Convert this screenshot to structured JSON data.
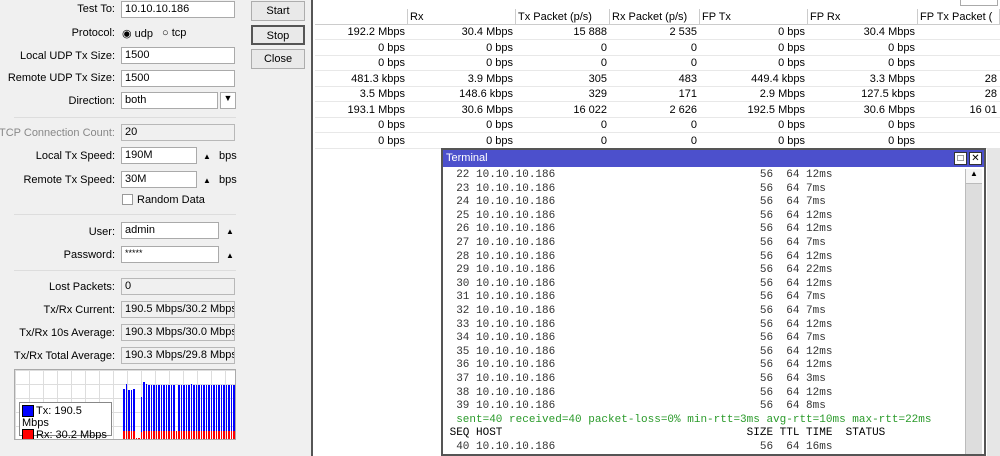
{
  "dialog": {
    "test_to_label": "Test To:",
    "test_to": "10.10.10.186",
    "protocol_label": "Protocol:",
    "protocol_options": [
      "udp",
      "tcp"
    ],
    "protocol_selected": "udp",
    "local_udp_label": "Local UDP Tx Size:",
    "local_udp": "1500",
    "remote_udp_label": "Remote UDP Tx Size:",
    "remote_udp": "1500",
    "direction_label": "Direction:",
    "direction": "both",
    "tcp_count_label": "TCP Connection Count:",
    "tcp_count": "20",
    "local_speed_label": "Local Tx Speed:",
    "local_speed": "190M",
    "remote_speed_label": "Remote Tx Speed:",
    "remote_speed": "30M",
    "unit": "bps",
    "random_data_label": "Random Data",
    "user_label": "User:",
    "user": "admin",
    "password_label": "Password:",
    "password": "*****",
    "lost_label": "Lost Packets:",
    "lost": "0",
    "current_label": "Tx/Rx Current:",
    "current": "190.5 Mbps/30.2 Mbps",
    "avg10_label": "Tx/Rx 10s Average:",
    "avg10": "190.3 Mbps/30.0 Mbps",
    "total_label": "Tx/Rx Total Average:",
    "total": "190.3 Mbps/29.8 Mbps",
    "buttons": {
      "start": "Start",
      "stop": "Stop",
      "close": "Close"
    },
    "graph": {
      "tx_legend": "Tx:  190.5 Mbps",
      "rx_legend": "Rx:  30.2 Mbps",
      "tx_color": "#0000ff",
      "rx_color": "#ff0000",
      "tx": [
        0.72,
        0.78,
        0.7,
        0.7,
        0.72,
        0,
        0,
        0.6,
        0.81,
        0.78,
        0.77,
        0.77,
        0.77,
        0.77,
        0.77,
        0.77,
        0.77,
        0.77,
        0.77,
        0.77,
        0.77,
        0,
        0.77,
        0.77,
        0.77,
        0.77,
        0.77,
        0.78,
        0.77,
        0.77,
        0.77,
        0.77,
        0.77,
        0.77,
        0.77,
        0.77,
        0.77,
        0.77,
        0.77,
        0.77,
        0.77,
        0.77,
        0.77,
        0.77,
        0.77
      ],
      "rx": [
        0.12,
        0.12,
        0.12,
        0.12,
        0.12,
        0.02,
        0.02,
        0.1,
        0.12,
        0.12,
        0.12,
        0.12,
        0.12,
        0.12,
        0.12,
        0.12,
        0.12,
        0.12,
        0.12,
        0.12,
        0.12,
        0.12,
        0.12,
        0.12,
        0.12,
        0.12,
        0.12,
        0.12,
        0.12,
        0.12,
        0.12,
        0.12,
        0.12,
        0.12,
        0.12,
        0.12,
        0.12,
        0.12,
        0.12,
        0.12,
        0.12,
        0.12,
        0.12,
        0.12,
        0.12
      ]
    }
  },
  "table": {
    "headers": [
      "",
      "Rx",
      "Tx Packet (p/s)",
      "Rx Packet (p/s)",
      "FP Tx",
      "FP Rx",
      "FP Tx Packet ("
    ],
    "rows": [
      [
        "192.2 Mbps",
        "30.4 Mbps",
        "15 888",
        "2 535",
        "0 bps",
        "30.4 Mbps",
        ""
      ],
      [
        "0 bps",
        "0 bps",
        "0",
        "0",
        "0 bps",
        "0 bps",
        ""
      ],
      [
        "0 bps",
        "0 bps",
        "0",
        "0",
        "0 bps",
        "0 bps",
        ""
      ],
      [
        "481.3 kbps",
        "3.9 Mbps",
        "305",
        "483",
        "449.4 kbps",
        "3.3 Mbps",
        "28"
      ],
      [
        "3.5 Mbps",
        "148.6 kbps",
        "329",
        "171",
        "2.9 Mbps",
        "127.5 kbps",
        "28"
      ],
      [
        "193.1 Mbps",
        "30.6 Mbps",
        "16 022",
        "2 626",
        "192.5 Mbps",
        "30.6 Mbps",
        "16 01"
      ],
      [
        "0 bps",
        "0 bps",
        "0",
        "0",
        "0 bps",
        "0 bps",
        ""
      ],
      [
        "0 bps",
        "0 bps",
        "0",
        "0",
        "0 bps",
        "0 bps",
        ""
      ]
    ]
  },
  "terminal": {
    "title": "Terminal",
    "lines": [
      "  22 10.10.10.186                               56  64 12ms",
      "  23 10.10.10.186                               56  64 7ms",
      "  24 10.10.10.186                               56  64 7ms",
      "  25 10.10.10.186                               56  64 12ms",
      "  26 10.10.10.186                               56  64 12ms",
      "  27 10.10.10.186                               56  64 7ms",
      "  28 10.10.10.186                               56  64 12ms",
      "  29 10.10.10.186                               56  64 22ms",
      "  30 10.10.10.186                               56  64 12ms",
      "  31 10.10.10.186                               56  64 7ms",
      "  32 10.10.10.186                               56  64 7ms",
      "  33 10.10.10.186                               56  64 12ms",
      "  34 10.10.10.186                               56  64 7ms",
      "  35 10.10.10.186                               56  64 12ms",
      "  36 10.10.10.186                               56  64 12ms",
      "  37 10.10.10.186                               56  64 3ms",
      "  38 10.10.10.186                               56  64 12ms",
      "  39 10.10.10.186                               56  64 8ms"
    ],
    "summary": "  sent=40 received=40 packet-loss=0% min-rtt=3ms avg-rtt=10ms max-rtt=22ms",
    "header": " SEQ HOST                                     SIZE TTL TIME  STATUS",
    "partial": "  40 10.10.10.186                               56  64 16ms"
  }
}
